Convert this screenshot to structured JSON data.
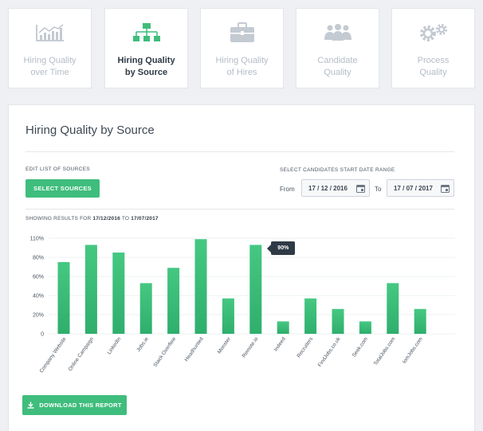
{
  "tabs": [
    {
      "label_line1": "Hiring Quality",
      "label_line2": "over Time",
      "icon": "line-chart-icon",
      "active": false
    },
    {
      "label_line1": "Hiring Quality",
      "label_line2": "by Source",
      "icon": "sitemap-icon",
      "active": true
    },
    {
      "label_line1": "Hiring Quality",
      "label_line2": "of Hires",
      "icon": "briefcase-icon",
      "active": false
    },
    {
      "label_line1": "Candidate",
      "label_line2": "Quality",
      "icon": "users-icon",
      "active": false
    },
    {
      "label_line1": "Process",
      "label_line2": "Quality",
      "icon": "gears-icon",
      "active": false
    }
  ],
  "card": {
    "title": "Hiring Quality by Source",
    "edit_sources_label": "EDIT LIST OF SOURCES",
    "select_sources_button": "SELECT SOURCES",
    "date_range_label": "SELECT CANDIDATES START DATE RANGE",
    "from_label": "From",
    "from_value": "17 / 12 / 2016",
    "to_label": "To",
    "to_value": "17 / 07 / 2017",
    "results_prefix": "SHOWING RESULTS FOR",
    "results_from": "17/12/2016",
    "results_to_word": "TO",
    "results_to": "17/07/2017",
    "download_button": "DOWNLOAD THIS REPORT"
  },
  "colors": {
    "accent": "#3fbd7c",
    "bar_top": "#45c882",
    "bar_bottom": "#2fae6c",
    "tooltip_bg": "#2e3a46"
  },
  "chart_data": {
    "type": "bar",
    "categories": [
      "Company Website",
      "Online Campaign",
      "LinkedIn",
      "Jobs.ie",
      "Stack Overflow",
      "Headhunted",
      "Monster",
      "Remote.io",
      "Indeed",
      "Recruiters",
      "FindJobs.co.uk",
      "Seek.com",
      "TotalJobs.com",
      "IomJobs.com"
    ],
    "values": [
      75,
      93,
      85,
      53,
      69,
      99,
      37,
      93,
      13,
      37,
      26,
      13,
      53,
      26
    ],
    "y_ticks": [
      "0",
      "20%",
      "40%",
      "60%",
      "80%",
      "110%"
    ],
    "ylim": [
      0,
      100
    ],
    "tooltip": {
      "category_index": 7,
      "text": "90%"
    },
    "grid": true
  }
}
